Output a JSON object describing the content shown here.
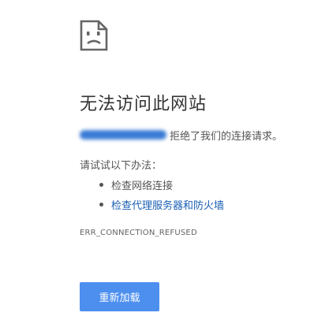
{
  "icon": "sad-page-icon",
  "title": "无法访问此网站",
  "error_message": {
    "host_redacted": "",
    "text": "拒绝了我们的连接请求。"
  },
  "suggestions": {
    "heading": "请试试以下办法：",
    "items": [
      {
        "label": "检查网络连接",
        "is_link": false
      },
      {
        "label": "检查代理服务器和防火墙",
        "is_link": true
      }
    ]
  },
  "error_code": "ERR_CONNECTION_REFUSED",
  "reload_button": {
    "label": "重新加载"
  },
  "colors": {
    "accent": "#4d8fef",
    "link": "#1a5fb4",
    "text": "#555555",
    "title": "#333333"
  }
}
